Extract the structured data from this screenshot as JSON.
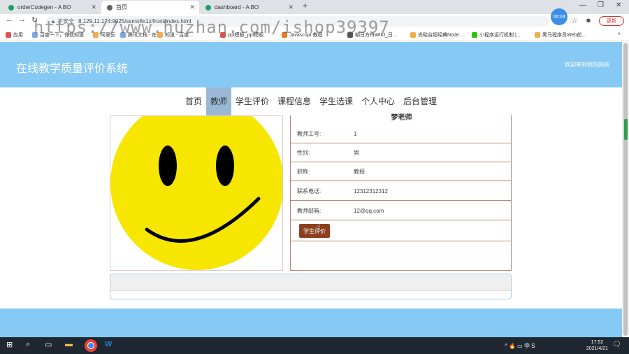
{
  "browser": {
    "tabs": [
      {
        "title": "orderCodegen - A BO",
        "color": "#1aa260"
      },
      {
        "title": "首页",
        "color": "#5f6368"
      },
      {
        "title": "dashboard - A BO",
        "color": "#1aa260"
      }
    ],
    "new_tab": "+",
    "address_warning": "▲ 不安全",
    "url": "8.129.11.174:9025/ssmo8x1z/front/index.html",
    "time_bubble": "06:04",
    "update_label": "更新",
    "bookmarks": [
      "应用",
      "百度一下，你就知道",
      "阿里云",
      "腾讯文档 - 在...",
      "知道 - 百度...",
      "ppt模板_ppt模板",
      "Javascript 教程",
      "朝日方舟WIKI_日...",
      "尚硅谷超经典Node...",
      "小程序运行机制 |...",
      "黑马程序员Web前..."
    ],
    "watermark": "https://www.huzhan.com/ishop39397"
  },
  "site": {
    "title": "在线教学质量评价系统",
    "welcome": "欢迎来到我的网站",
    "nav": [
      {
        "label": "首页",
        "active": false
      },
      {
        "label": "教师",
        "active": true
      },
      {
        "label": "学生评价",
        "active": false
      },
      {
        "label": "课程信息",
        "active": false
      },
      {
        "label": "学生选课",
        "active": false
      },
      {
        "label": "个人中心",
        "active": false
      },
      {
        "label": "后台管理",
        "active": false
      }
    ]
  },
  "teacher": {
    "name": "梦老师",
    "fields": [
      {
        "label": "教师工号:",
        "value": "1"
      },
      {
        "label": "性别:",
        "value": "男"
      },
      {
        "label": "职称:",
        "value": "教授"
      },
      {
        "label": "联系电话:",
        "value": "12312312312"
      },
      {
        "label": "教师邮箱:",
        "value": "12@qq.com"
      }
    ],
    "evaluate_label": "学生评价"
  },
  "taskbar": {
    "time": "17:52",
    "date": "2021/4/21",
    "tray": "^ 🔥 ▭ 中 S"
  }
}
